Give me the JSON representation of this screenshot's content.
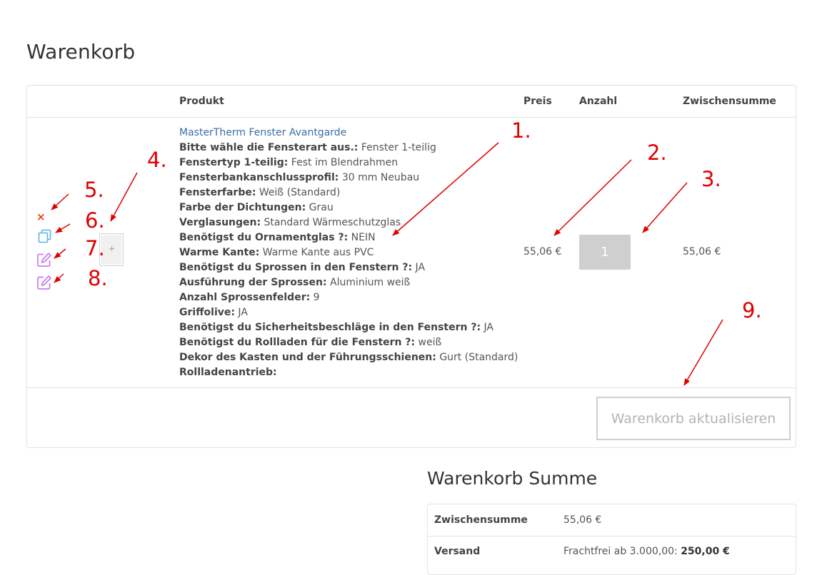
{
  "page": {
    "title": "Warenkorb"
  },
  "cart": {
    "columns": {
      "product": "Produkt",
      "price": "Preis",
      "quantity": "Anzahl",
      "subtotal": "Zwischensumme"
    },
    "item": {
      "remove_icon": "×",
      "product_name": "MasterTherm Fenster Avantgarde",
      "attributes": [
        {
          "key": "Bitte wähle die Fensterart aus.:",
          "value": " Fenster 1-teilig"
        },
        {
          "key": "Fenstertyp 1-teilig:",
          "value": " Fest im Blendrahmen"
        },
        {
          "key": "Fensterbankanschlussprofil:",
          "value": " 30 mm Neubau"
        },
        {
          "key": "Fensterfarbe:",
          "value": " Weiß (Standard)"
        },
        {
          "key": "Farbe der Dichtungen:",
          "value": " Grau"
        },
        {
          "key": "Verglasungen:",
          "value": " Standard Wärmeschutzglas"
        },
        {
          "key": "Benötigst du Ornamentglas ?:",
          "value": " NEIN"
        },
        {
          "key": "Warme Kante:",
          "value": " Warme Kante aus PVC"
        },
        {
          "key": "Benötigst du Sprossen in den Fenstern ?:",
          "value": " JA"
        },
        {
          "key": "Ausführung der Sprossen:",
          "value": " Aluminium weiß"
        },
        {
          "key": "Anzahl Sprossenfelder:",
          "value": " 9"
        },
        {
          "key": "Griffolive:",
          "value": " JA"
        },
        {
          "key": "Benötigst du Sicherheitsbeschläge in den Fenstern ?:",
          "value": " JA"
        },
        {
          "key": "Benötigst du Rollladen für die Fenstern ?:",
          "value": " weiß"
        },
        {
          "key": "Dekor des Kasten und der Führungsschienen:",
          "value": " Gurt (Standard)"
        },
        {
          "key": "Rollladenantrieb:",
          "value": ""
        }
      ],
      "price": "55,06 €",
      "quantity": "1",
      "subtotal": "55,06 €"
    },
    "update_button": "Warenkorb aktualisieren"
  },
  "totals": {
    "title": "Warenkorb Summe",
    "rows": [
      {
        "label": "Zwischensumme",
        "value": "55,06 €"
      },
      {
        "label": "Versand",
        "value_prefix": "Frachtfrei ab 3.000,00: ",
        "value_bold": "250,00 €"
      }
    ]
  },
  "annotations": {
    "color": "#e00000",
    "labels": [
      "1.",
      "2.",
      "3.",
      "4.",
      "5.",
      "6.",
      "7.",
      "8.",
      "9."
    ]
  },
  "colors": {
    "link": "#3a6ea8",
    "remove": "#e2401c",
    "copy_icon": "#5ab4e6",
    "edit_icon": "#c77df0"
  }
}
